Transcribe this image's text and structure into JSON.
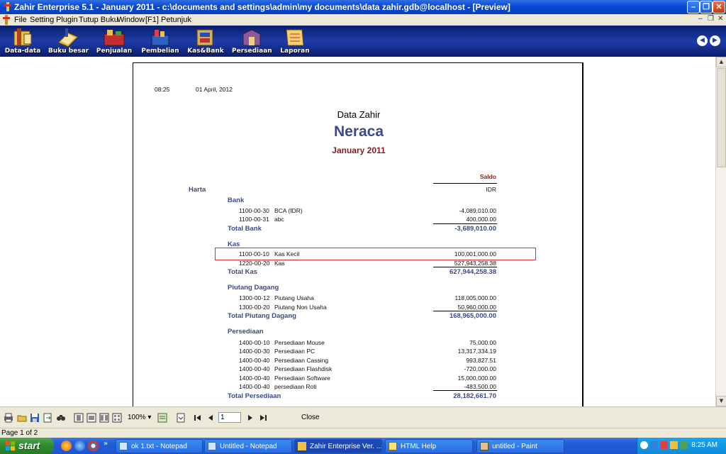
{
  "window": {
    "title": "Zahir Enterprise 5.1 - January 2011 - c:\\documents and settings\\admin\\my documents\\data zahir.gdb@localhost - [Preview]"
  },
  "menu": [
    "File",
    "Setting",
    "Plugin",
    "Tutup Buku",
    "Window",
    "[F1] Petunjuk"
  ],
  "toolbar": [
    {
      "label": "Data-data",
      "icon": "data-icon"
    },
    {
      "label": "Buku besar",
      "icon": "ledger-icon"
    },
    {
      "label": "Penjualan",
      "icon": "sales-icon"
    },
    {
      "label": "Pembelian",
      "icon": "purchase-icon"
    },
    {
      "label": "Kas&Bank",
      "icon": "cash-bank-icon"
    },
    {
      "label": "Persediaan",
      "icon": "inventory-icon"
    },
    {
      "label": "Laporan",
      "icon": "report-icon"
    }
  ],
  "report": {
    "time": "08:25",
    "date": "01 April, 2012",
    "company": "Data Zahir",
    "title": "Neraca",
    "period": "January 2011",
    "col_header": "Saldo",
    "currency": "IDR",
    "group": "Harta",
    "sections": [
      {
        "name": "Bank",
        "rows": [
          {
            "code": "1100-00-30",
            "name": "BCA (IDR)",
            "amount": "-4,089,010.00"
          },
          {
            "code": "1100-00-31",
            "name": "abc",
            "amount": "400,000.00"
          }
        ],
        "total_label": "Total Bank",
        "total": "-3,689,010.00"
      },
      {
        "name": "Kas",
        "rows": [
          {
            "code": "1100-00-10",
            "name": "Kas Kecil",
            "amount": "100,001,000.00"
          },
          {
            "code": "1220-00-20",
            "name": "Kas",
            "amount": "527,943,258.38"
          }
        ],
        "total_label": "Total Kas",
        "total": "627,944,258.38"
      },
      {
        "name": "Piutang Dagang",
        "rows": [
          {
            "code": "1300-00-12",
            "name": "Piutang Usaha",
            "amount": "118,005,000.00"
          },
          {
            "code": "1300-00-20",
            "name": "Piutang Non Usaha",
            "amount": "50,960,000.00"
          }
        ],
        "total_label": "Total Piutang Dagang",
        "total": "168,965,000.00"
      },
      {
        "name": "Persediaan",
        "rows": [
          {
            "code": "1400-00-10",
            "name": "Persediaan Mouse",
            "amount": "75,000.00"
          },
          {
            "code": "1400-00-30",
            "name": "Persediaan PC",
            "amount": "13,317,334.19"
          },
          {
            "code": "1400-00-40",
            "name": "Persediaan Cassing",
            "amount": "993,827.51"
          },
          {
            "code": "1400-00-40",
            "name": "Persediaan Flashdisk",
            "amount": "-720,000.00"
          },
          {
            "code": "1400-00-40",
            "name": "Persediaan Software",
            "amount": "15,000,000.00"
          },
          {
            "code": "1400-00-40",
            "name": "persediaan Roti",
            "amount": "-483,500.00"
          }
        ],
        "total_label": "Total Persediaan",
        "total": "28,182,661.70"
      }
    ]
  },
  "preview_bar": {
    "zoom": "100%",
    "page_input": "1",
    "close_label": "Close"
  },
  "status": {
    "text": "Page 1 of 2"
  },
  "taskbar": {
    "start_label": "start",
    "tasks": [
      {
        "label": "ok 1.txt - Notepad",
        "active": false
      },
      {
        "label": "Untitled - Notepad",
        "active": false
      },
      {
        "label": "Zahir Enterprise Ver. ...",
        "active": true
      },
      {
        "label": "HTML Help",
        "active": false
      },
      {
        "label": "untitled - Paint",
        "active": false
      }
    ],
    "clock": "8:25 AM"
  }
}
